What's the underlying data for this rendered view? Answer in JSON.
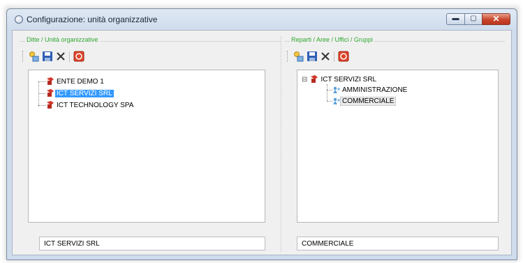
{
  "window": {
    "title": "Configurazione: unità organizzative"
  },
  "controls": {
    "minimize_icon": "minimize-icon",
    "maximize_icon": "maximize-icon",
    "close_icon": "close-icon"
  },
  "left_panel": {
    "group_label": "Ditte / Unità organizzative",
    "toolbar": [
      "new-icon",
      "save-icon",
      "delete-icon",
      "stop-icon"
    ],
    "tree": [
      {
        "label": "ENTE DEMO 1",
        "state": "normal"
      },
      {
        "label": "ICT SERVIZI SRL",
        "state": "selected"
      },
      {
        "label": "ICT TECHNOLOGY SPA",
        "state": "normal"
      }
    ],
    "field_value": "ICT SERVIZI SRL"
  },
  "right_panel": {
    "group_label": "Reparti / Aree / Uffici / Gruppi",
    "toolbar": [
      "new-icon",
      "save-icon",
      "delete-icon",
      "stop-icon"
    ],
    "tree_root": {
      "label": "ICT SERVIZI SRL",
      "expander": "⊟"
    },
    "tree_children": [
      {
        "label": "AMMINISTRAZIONE",
        "state": "normal"
      },
      {
        "label": "COMMERCIALE",
        "state": "highlighted"
      }
    ],
    "field_value": "COMMERCIALE"
  },
  "colors": {
    "group_label": "#2fa62f",
    "selection": "#3399ff",
    "close_button": "#c9452c"
  }
}
